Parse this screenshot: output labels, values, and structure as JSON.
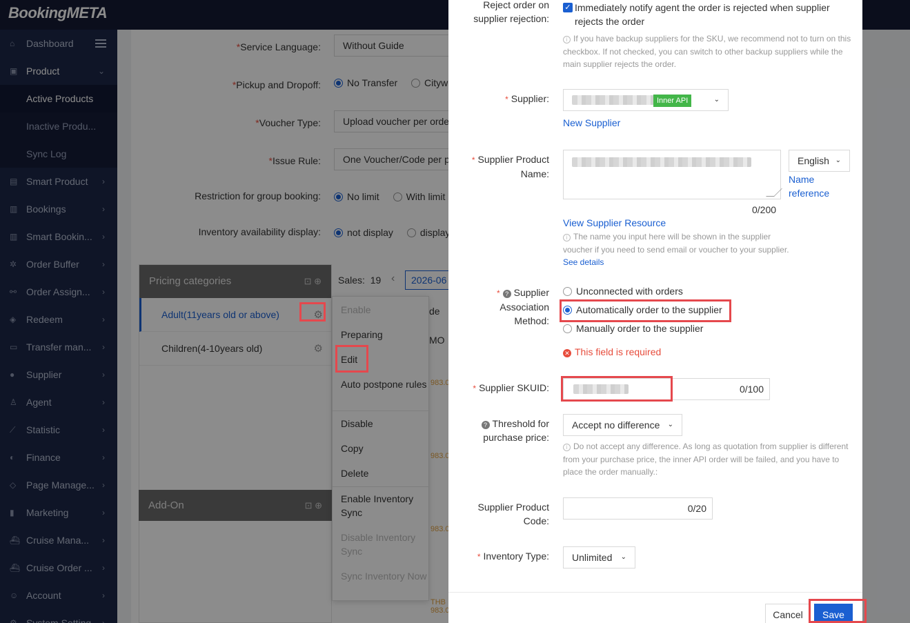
{
  "app": {
    "logo": "BookingMETA"
  },
  "sidebar": {
    "items": [
      {
        "label": "Dashboard",
        "icon": "home-icon"
      },
      {
        "label": "Product",
        "icon": "bag-icon"
      },
      {
        "label": "Smart Product",
        "icon": "box-icon"
      },
      {
        "label": "Bookings",
        "icon": "doc-icon"
      },
      {
        "label": "Smart Bookin...",
        "icon": "doc-icon"
      },
      {
        "label": "Order Buffer",
        "icon": "gear-icon"
      },
      {
        "label": "Order Assign...",
        "icon": "share-icon"
      },
      {
        "label": "Redeem",
        "icon": "cube-icon"
      },
      {
        "label": "Transfer man...",
        "icon": "car-icon"
      },
      {
        "label": "Supplier",
        "icon": "user-icon"
      },
      {
        "label": "Agent",
        "icon": "agent-icon"
      },
      {
        "label": "Statistic",
        "icon": "chart-icon"
      },
      {
        "label": "Finance",
        "icon": "finance-icon"
      },
      {
        "label": "Page Manage...",
        "icon": "page-icon"
      },
      {
        "label": "Marketing",
        "icon": "bars-icon"
      },
      {
        "label": "Cruise Mana...",
        "icon": "ship-icon"
      },
      {
        "label": "Cruise Order ...",
        "icon": "ship-icon"
      },
      {
        "label": "Account",
        "icon": "account-icon"
      },
      {
        "label": "System Setting",
        "icon": "settings-icon"
      }
    ],
    "product_sub": [
      "Active Products",
      "Inactive Produ...",
      "Sync Log"
    ]
  },
  "background_form": {
    "service_language_label": "Service Language:",
    "service_language_value": "Without Guide",
    "pickup_label": "Pickup and Dropoff:",
    "pickup_opt1": "No Transfer",
    "pickup_opt2": "Citywi",
    "voucher_type_label": "Voucher Type:",
    "voucher_type_value": "Upload voucher per orde",
    "issue_rule_label": "Issue Rule:",
    "issue_rule_value": "One Voucher/Code per p",
    "restriction_label": "Restriction for group booking:",
    "restriction_opt1": "No limit",
    "restriction_opt2": "With limit",
    "inventory_display_label": "Inventory availability display:",
    "inventory_display_opt1": "not display",
    "inventory_display_opt2": "display",
    "pricing_title": "Pricing categories",
    "pricing_rows": [
      "Adult(11years old or above)",
      "Children(4-10years old)"
    ],
    "addon_title": "Add-On",
    "sales_label": "Sales:",
    "sales_value": "19",
    "date_value": "2026-06",
    "col_partial1": "de",
    "col_partial2": "MO",
    "price_partial": "983.0",
    "price_bottom": "THB 983.00"
  },
  "context_menu": {
    "items": [
      "Enable",
      "Preparing",
      "Edit",
      "Auto postpone rules",
      "Disable",
      "Copy",
      "Delete",
      "Enable Inventory Sync",
      "Disable Inventory Sync",
      "Sync Inventory Now"
    ]
  },
  "drawer": {
    "reject_label": "Reject order on supplier rejection:",
    "reject_checkbox_text": "Immediately notify agent the order is rejected when supplier rejects the order",
    "reject_hint": "If you have backup suppliers for the SKU, we recommend not to turn on this checkbox. If not checked, you can switch to other backup suppliers while the main supplier rejects the order.",
    "supplier_label": "Supplier:",
    "supplier_tag": "Inner API",
    "new_supplier": "New Supplier",
    "supplier_product_name_label": "Supplier Product Name:",
    "language_value": "English",
    "name_reference": "Name reference",
    "name_counter": "0/200",
    "view_supplier_resource": "View Supplier Resource",
    "name_hint": "The name you input here will be shown in the supplier voucher if you need to send email or voucher to your supplier.",
    "see_details": "See details",
    "association_label": "Supplier Association Method:",
    "assoc_opt1": "Unconnected with orders",
    "assoc_opt2": "Automatically order to the supplier",
    "assoc_opt3": "Manually order to the supplier",
    "required_error": "This field is required",
    "skuid_label": "Supplier SKUID:",
    "skuid_counter": "0/100",
    "threshold_label": "Threshold for purchase price:",
    "threshold_value": "Accept no difference",
    "threshold_hint": "Do not accept any difference. As long as quotation from supplier is different from your purchase price, the inner API order will be failed, and you have to place the order manually.:",
    "product_code_label": "Supplier Product Code:",
    "product_code_counter": "0/20",
    "inventory_type_label": "Inventory Type:",
    "inventory_type_value": "Unlimited",
    "cancel_label": "Cancel",
    "save_label": "Save"
  },
  "colors": {
    "primary": "#1a5fd1",
    "sidebar": "#1c2747",
    "topbar": "#141a33",
    "error": "#e74c3c",
    "highlight": "#e5484d",
    "tag_green": "#43b649"
  }
}
